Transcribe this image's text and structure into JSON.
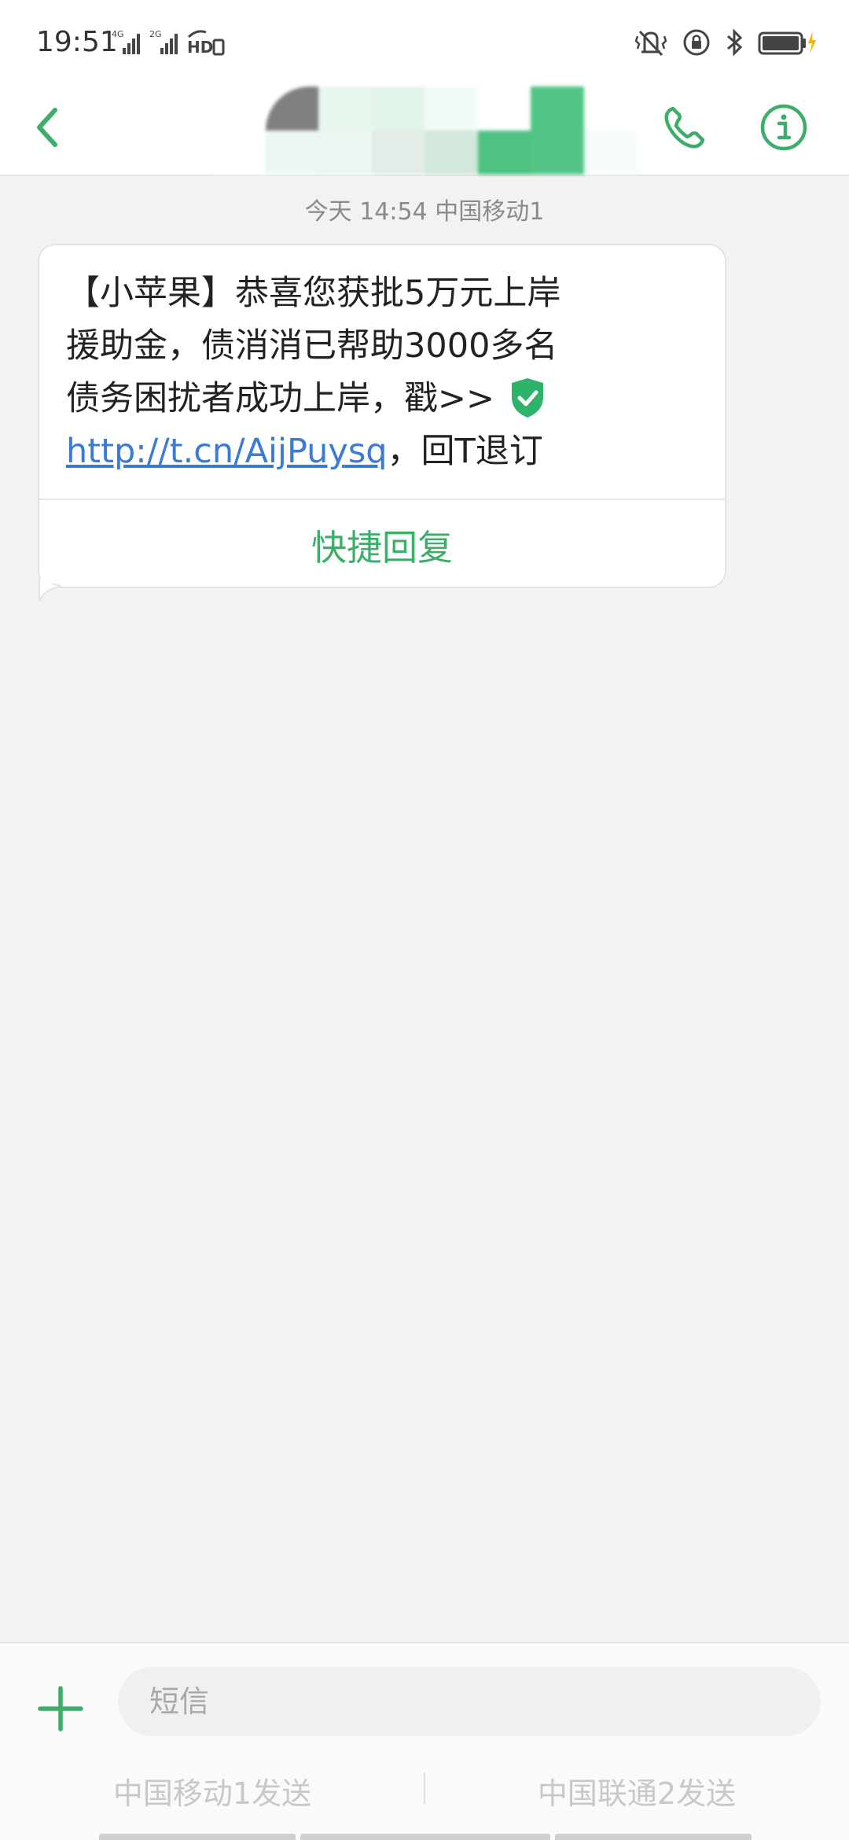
{
  "status_bar": {
    "time": "19:51",
    "network1": "4G",
    "network2": "2G",
    "hd_label": "HD"
  },
  "header": {
    "back_icon": "chevron-left-icon",
    "call_icon": "phone-icon",
    "info_icon": "info-icon",
    "accent_color": "#3dae6a"
  },
  "conversation": {
    "timestamp": "今天 14:54  中国移动1",
    "message": {
      "line1": "【小苹果】恭喜您获批5万元上岸",
      "line2": "援助金，债消消已帮助3000多名",
      "line3": "债务困扰者成功上岸，戳>>",
      "link": "http://t.cn/AijPuysq",
      "line4_suffix": "，回T退订"
    },
    "quick_reply_label": "快捷回复"
  },
  "composer": {
    "input_placeholder": "短信",
    "send_sim1_label": "中国移动1发送",
    "send_sim2_label": "中国联通2发送"
  }
}
